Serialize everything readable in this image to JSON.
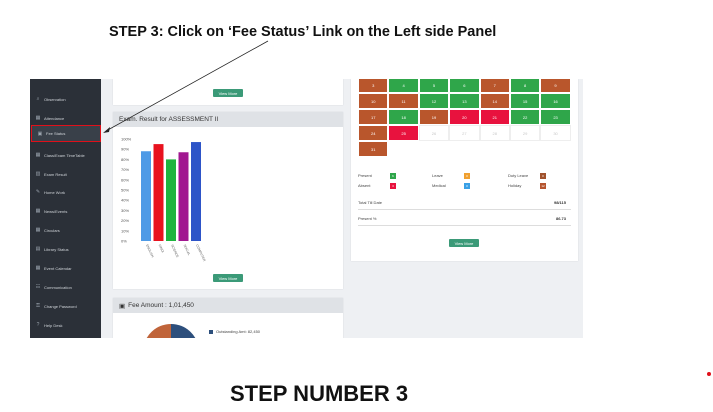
{
  "instruction": "STEP 3: Click on ‘Fee Status’ Link on the Left side Panel",
  "bottom_title": "STEP NUMBER 3",
  "sidebar": {
    "items": [
      {
        "label": "Observation",
        "icon": "search-icon",
        "glyph": "⌕"
      },
      {
        "label": "Attendance",
        "icon": "calendar-icon",
        "glyph": "▦"
      },
      {
        "label": "Fee Status",
        "icon": "money-icon",
        "glyph": "▣"
      },
      {
        "label": "Class/Exam TimeTable",
        "icon": "calendar-icon",
        "glyph": "▦"
      },
      {
        "label": "Exam Result",
        "icon": "bar-chart-icon",
        "glyph": "▥"
      },
      {
        "label": "Home Work",
        "icon": "edit-icon",
        "glyph": "✎"
      },
      {
        "label": "News/Events",
        "icon": "calendar-icon",
        "glyph": "▦"
      },
      {
        "label": "Circulars",
        "icon": "calendar-icon",
        "glyph": "▦"
      },
      {
        "label": "Library Status",
        "icon": "book-icon",
        "glyph": "▤"
      },
      {
        "label": "Event Calendar",
        "icon": "calendar-icon",
        "glyph": "▦"
      },
      {
        "label": "Communication",
        "icon": "users-icon",
        "glyph": "☷"
      },
      {
        "label": "Change Password",
        "icon": "lock-icon",
        "glyph": "⚿"
      },
      {
        "label": "Help Desk",
        "icon": "question-icon",
        "glyph": "?"
      }
    ]
  },
  "exam_panel": {
    "title": "Exam. Result for ASSESSMENT II",
    "view_more": "View More"
  },
  "top_view_more": "View More",
  "fee_panel": {
    "title": "Fee Amount : 1,01,450",
    "legend": "Outstanding Amt: 82,450"
  },
  "chart_data": {
    "type": "bar",
    "categories": [
      "ENGLISH",
      "HINDI",
      "SCIENCE",
      "SOCIAL",
      "COMPUTER"
    ],
    "values": [
      88,
      95,
      80,
      87,
      97
    ],
    "colors": [
      "#4e9ae6",
      "#e8121e",
      "#1db43e",
      "#a11790",
      "#2d54c8"
    ],
    "yticks": [
      "100%",
      "90%",
      "80%",
      "70%",
      "60%",
      "50%",
      "40%",
      "30%",
      "20%",
      "10%",
      "0%"
    ],
    "ylim": [
      0,
      100
    ]
  },
  "calendar": {
    "cells": [
      {
        "d": "3",
        "s": "holiday"
      },
      {
        "d": "4",
        "s": "present"
      },
      {
        "d": "5",
        "s": "present"
      },
      {
        "d": "6",
        "s": "present"
      },
      {
        "d": "7",
        "s": "holiday"
      },
      {
        "d": "8",
        "s": "present"
      },
      {
        "d": "9",
        "s": "holiday"
      },
      {
        "d": "10",
        "s": "holiday"
      },
      {
        "d": "11",
        "s": "holiday"
      },
      {
        "d": "12",
        "s": "present"
      },
      {
        "d": "13",
        "s": "present"
      },
      {
        "d": "14",
        "s": "holiday"
      },
      {
        "d": "15",
        "s": "present"
      },
      {
        "d": "16",
        "s": "present"
      },
      {
        "d": "17",
        "s": "holiday"
      },
      {
        "d": "18",
        "s": "present"
      },
      {
        "d": "19",
        "s": "holiday"
      },
      {
        "d": "20",
        "s": "absent"
      },
      {
        "d": "21",
        "s": "absent"
      },
      {
        "d": "22",
        "s": "present"
      },
      {
        "d": "23",
        "s": "present"
      },
      {
        "d": "24",
        "s": "holiday"
      },
      {
        "d": "25",
        "s": "absent"
      },
      {
        "d": "26",
        "s": "empty"
      },
      {
        "d": "27",
        "s": "empty"
      },
      {
        "d": "28",
        "s": "empty"
      },
      {
        "d": "29",
        "s": "empty"
      },
      {
        "d": "30",
        "s": "empty"
      },
      {
        "d": "31",
        "s": "holiday"
      }
    ],
    "legend": [
      {
        "label": "Present",
        "count": "6",
        "color": "#2fa64a"
      },
      {
        "label": "Leave",
        "count": "0",
        "color": "#f0a030"
      },
      {
        "label": "Duty Leave",
        "count": "0",
        "color": "#a0522d"
      },
      {
        "label": "Absent",
        "count": "3",
        "color": "#e8123e"
      },
      {
        "label": "Medical",
        "count": "0",
        "color": "#3aa0e6"
      },
      {
        "label": "Holiday",
        "count": "12",
        "color": "#b5552f"
      }
    ],
    "total_label": "Total Till Date",
    "total_value": "98/115",
    "percent_label": "Present %",
    "percent_value": "86.73",
    "view_more": "View More"
  },
  "colors": {
    "present": "#2fa64a",
    "holiday": "#b9562c",
    "absent": "#e8123e",
    "empty": "#ffffff",
    "sidebar_bg": "#2b3038",
    "button": "#3b9a78",
    "highlight": "#e0101a"
  }
}
